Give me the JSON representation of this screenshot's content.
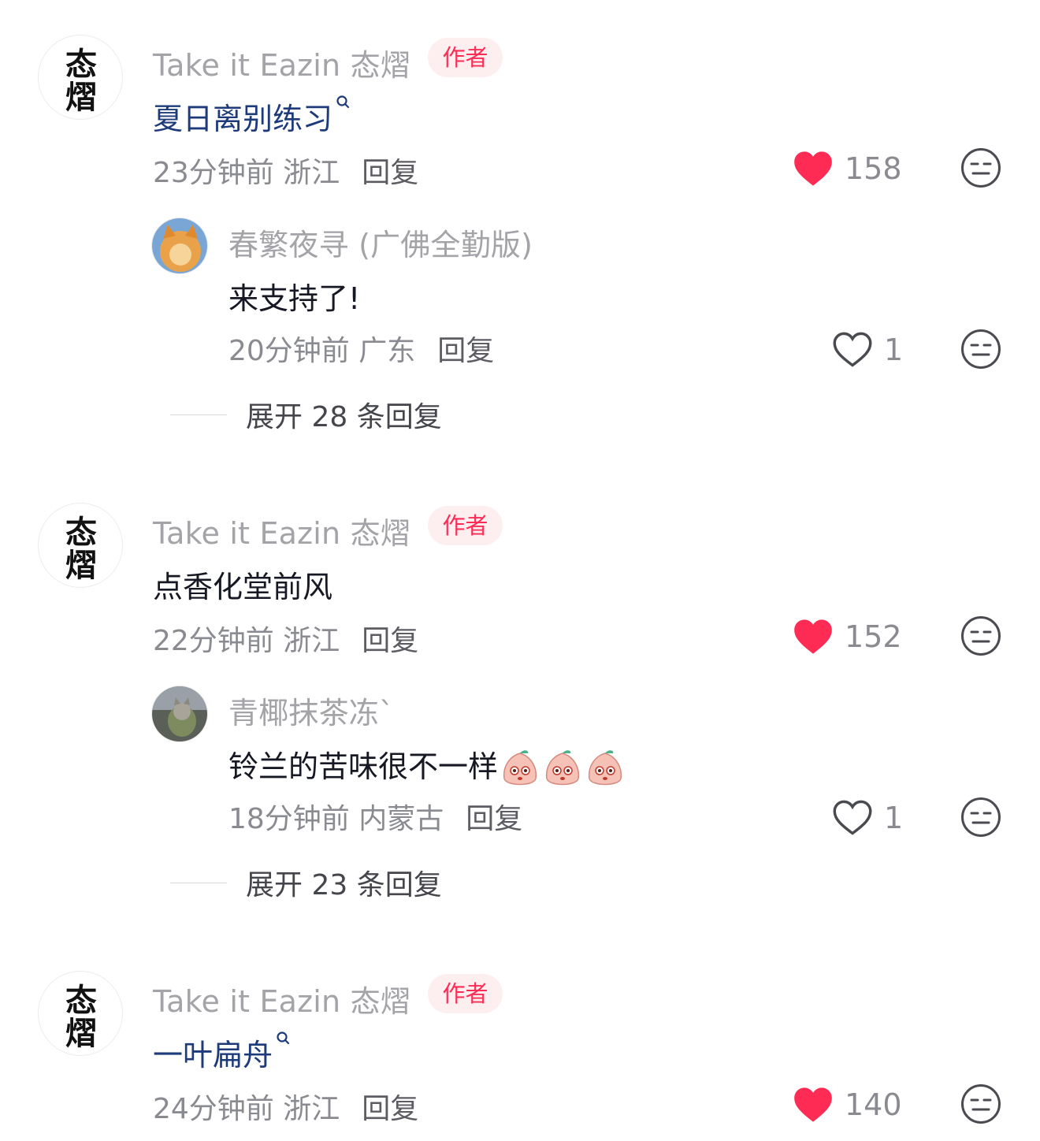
{
  "comments": [
    {
      "author": "Take it Eazin 态熠",
      "badge": "作者",
      "text": "夏日离别练习",
      "meta": "23分钟前 浙江",
      "reply": "回复",
      "likes": "158",
      "liked": true,
      "reply_item": {
        "author": "春繁夜寻 (广佛全勤版)",
        "text": "来支持了!",
        "meta": "20分钟前 广东",
        "reply": "回复",
        "likes": "1"
      },
      "expand": "展开 28 条回复"
    },
    {
      "author": "Take it Eazin 态熠",
      "badge": "作者",
      "text": "点香化堂前风",
      "meta": "22分钟前 浙江",
      "reply": "回复",
      "likes": "152",
      "liked": true,
      "reply_item": {
        "author": "青椰抹茶冻`",
        "text": "铃兰的苦味很不一样",
        "meta": "18分钟前 内蒙古",
        "reply": "回复",
        "likes": "1"
      },
      "expand": "展开 23 条回复"
    },
    {
      "author": "Take it Eazin 态熠",
      "badge": "作者",
      "text": "一叶扁舟",
      "meta": "24分钟前 浙江",
      "reply": "回复",
      "likes": "140",
      "liked": true
    }
  ],
  "colors": {
    "like_red": "#fe2c55",
    "search_blue": "#1d3b7a",
    "muted": "#8a8b91"
  },
  "icons": [
    "heart-filled-icon",
    "heart-outline-icon",
    "dislike-face-icon",
    "search-mark-icon",
    "peach-emoji-icon"
  ]
}
